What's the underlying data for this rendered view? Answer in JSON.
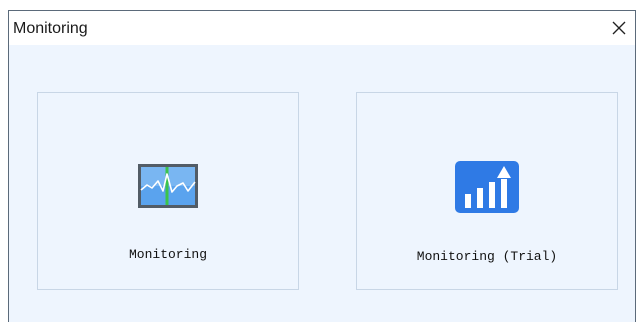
{
  "window": {
    "title": "Monitoring"
  },
  "options": [
    {
      "label": "Monitoring",
      "icon": "monitor-waveform-icon"
    },
    {
      "label": "Monitoring (Trial)",
      "icon": "bar-chart-up-arrow-icon"
    }
  ],
  "colors": {
    "background": "#eef5fe",
    "tile_border": "#c8d6e6",
    "icon_blue": "#2f7ae5",
    "icon_green": "#3cb44b"
  }
}
